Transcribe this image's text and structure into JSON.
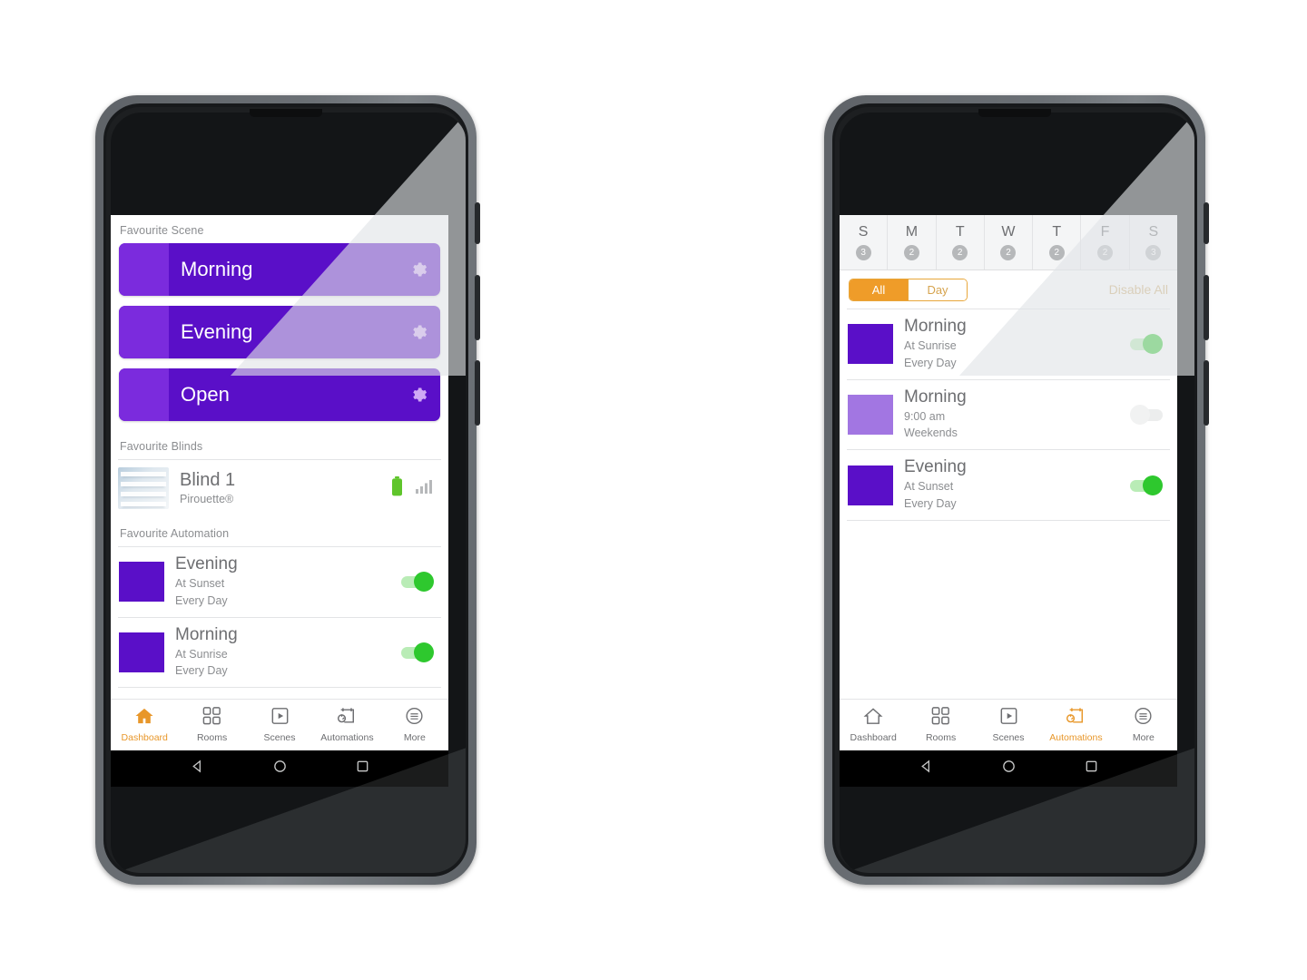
{
  "app": {
    "accent_orange": "#e8972a",
    "purple_dark": "#5a0fc8",
    "purple_light": "#7b2bdd",
    "toggle_on_green": "#2ec82e"
  },
  "left_phone": {
    "sections": {
      "scenes_label": "Favourite Scene",
      "blinds_label": "Favourite Blinds",
      "automation_label": "Favourite Automation"
    },
    "scenes": [
      {
        "name": "Morning",
        "gear_icon": "gear-icon"
      },
      {
        "name": "Evening",
        "gear_icon": "gear-icon"
      },
      {
        "name": "Open",
        "gear_icon": "gear-icon"
      }
    ],
    "blinds": [
      {
        "name": "Blind 1",
        "type": "Pirouette®",
        "battery_icon": "battery-icon",
        "signal_icon": "signal-icon"
      }
    ],
    "automations": [
      {
        "name": "Evening",
        "trigger": "At Sunset",
        "schedule": "Every Day",
        "enabled": true
      },
      {
        "name": "Morning",
        "trigger": "At Sunrise",
        "schedule": "Every Day",
        "enabled": true
      }
    ],
    "tabs": [
      {
        "label": "Dashboard",
        "icon": "home-icon",
        "active": true
      },
      {
        "label": "Rooms",
        "icon": "rooms-icon",
        "active": false
      },
      {
        "label": "Scenes",
        "icon": "scenes-icon",
        "active": false
      },
      {
        "label": "Automations",
        "icon": "automations-icon",
        "active": false
      },
      {
        "label": "More",
        "icon": "more-icon",
        "active": false
      }
    ]
  },
  "right_phone": {
    "days": [
      {
        "letter": "S",
        "count": "3"
      },
      {
        "letter": "M",
        "count": "2"
      },
      {
        "letter": "T",
        "count": "2"
      },
      {
        "letter": "W",
        "count": "2"
      },
      {
        "letter": "T",
        "count": "2"
      },
      {
        "letter": "F",
        "count": "2"
      },
      {
        "letter": "S",
        "count": "3"
      }
    ],
    "filter": {
      "all_label": "All",
      "day_label": "Day",
      "selected": "All",
      "disable_all_label": "Disable All"
    },
    "automations": [
      {
        "name": "Morning",
        "trigger": "At Sunrise",
        "schedule": "Every Day",
        "enabled": true,
        "swatch": "dark"
      },
      {
        "name": "Morning",
        "trigger": "9:00 am",
        "schedule": "Weekends",
        "enabled": false,
        "swatch": "light"
      },
      {
        "name": "Evening",
        "trigger": "At Sunset",
        "schedule": "Every Day",
        "enabled": true,
        "swatch": "dark"
      }
    ],
    "tabs": [
      {
        "label": "Dashboard",
        "icon": "home-icon",
        "active": false
      },
      {
        "label": "Rooms",
        "icon": "rooms-icon",
        "active": false
      },
      {
        "label": "Scenes",
        "icon": "scenes-icon",
        "active": false
      },
      {
        "label": "Automations",
        "icon": "automations-icon",
        "active": true
      },
      {
        "label": "More",
        "icon": "more-icon",
        "active": false
      }
    ]
  },
  "android_nav": {
    "back": "back-triangle-icon",
    "home": "home-circle-icon",
    "recents": "recents-square-icon"
  }
}
